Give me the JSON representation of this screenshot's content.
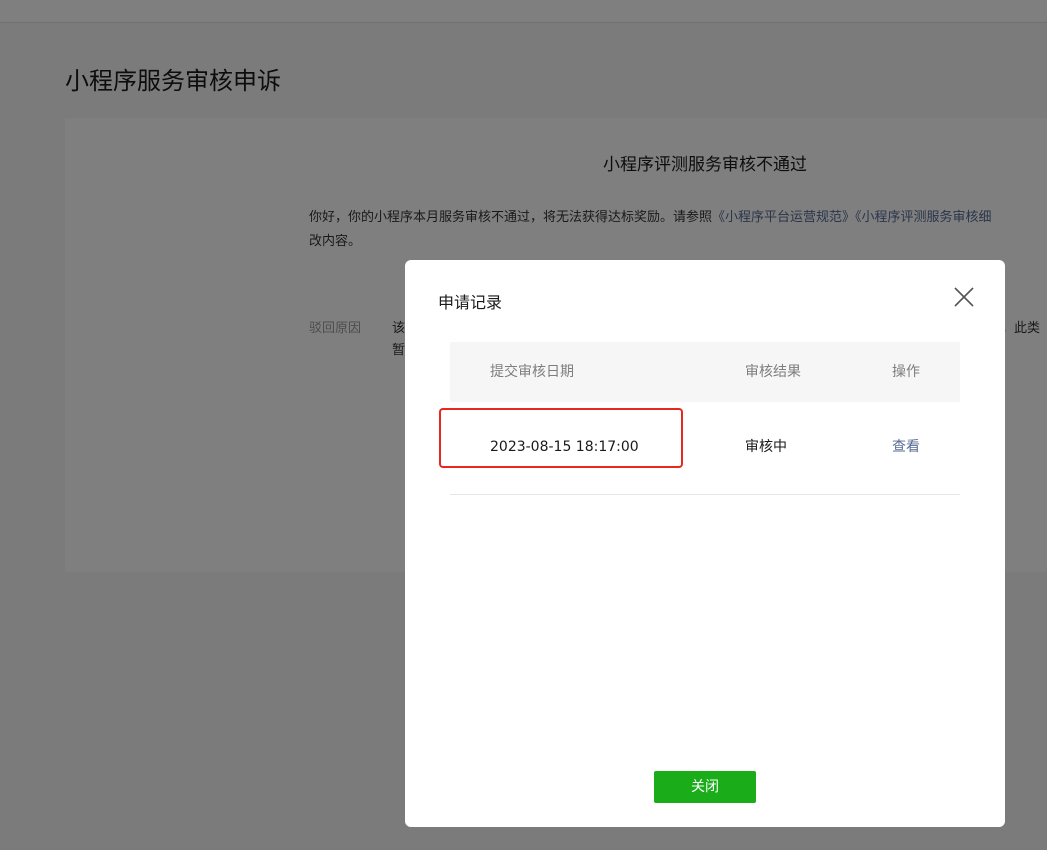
{
  "page": {
    "title": "小程序服务审核申诉"
  },
  "panel": {
    "heading": "小程序评测服务审核不通过",
    "desc_text": "你好，你的小程序本月服务审核不通过，将无法获得达标奖励。请参照",
    "link1": "《小程序平台运营规范》",
    "link2": "《小程序评测服务审核细",
    "desc_line2": "改内容。",
    "reject_label": "驳回原因",
    "reject_text_line1": "该",
    "reject_text_line2": "暂",
    "reject_tail": "，此类"
  },
  "dialog": {
    "title": "申请记录",
    "columns": {
      "date": "提交审核日期",
      "result": "审核结果",
      "action": "操作"
    },
    "rows": [
      {
        "date": "2023-08-15 18:17:00",
        "result": "审核中",
        "action": "查看"
      }
    ],
    "close_label": "关闭"
  },
  "colors": {
    "primary_green": "#1aad19",
    "link_blue": "#576b95",
    "highlight_red": "#e8281f"
  },
  "icons": {
    "close": "close-x-icon"
  }
}
